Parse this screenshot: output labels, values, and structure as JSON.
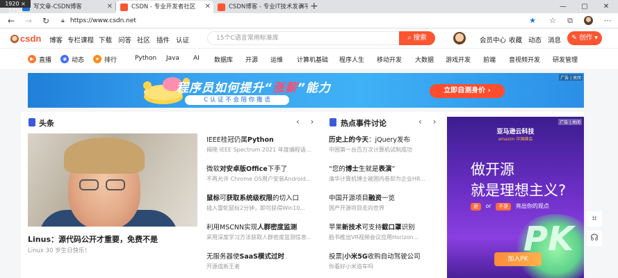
{
  "screen_badge": "1920 × 1030",
  "tabs": [
    {
      "title": "写文章-CSDN博客",
      "active": false,
      "favicon_color": "#1e73d4"
    },
    {
      "title": "CSDN - 专业开发者社区",
      "active": true,
      "favicon_color": "#fc5531"
    },
    {
      "title": "CSDN博客 - 专业IT技术发表平台",
      "active": false,
      "favicon_color": "#fc5531"
    }
  ],
  "tab_close_glyph": "✕",
  "new_tab_glyph": "+",
  "window_controls": {
    "minimize": "—",
    "maximize": "▢",
    "close": "✕"
  },
  "browser": {
    "url": "https://www.csdn.net",
    "icons": {
      "back": "arrow-left",
      "forward": "arrow-right",
      "refresh": "refresh",
      "home": "home",
      "favorite": "star",
      "collections": "collections",
      "extensions": "extensions",
      "profile": "profile-avatar",
      "menu": "more"
    },
    "glyphs": {
      "back": "←",
      "forward": "→",
      "refresh": "↻",
      "home": "⌂",
      "lock": "🔒︎",
      "star": "★",
      "collections": "☆",
      "extensions": "⧉",
      "more": "⋯"
    }
  },
  "header": {
    "logo_text": "csdn",
    "nav": [
      "博客",
      "专栏课程",
      "下载",
      "问答",
      "社区",
      "插件",
      "认证"
    ],
    "search_placeholder": "15个C语言常用标准库",
    "search_button": "搜索",
    "links": [
      "会员中心",
      "收藏",
      "动态",
      "消息"
    ],
    "create_button": "创作",
    "create_dropdown_glyph": "▾"
  },
  "categories": {
    "featured": [
      {
        "label": "直播",
        "icon": "live-icon",
        "color": "#ff7a2f"
      },
      {
        "label": "动态",
        "icon": "dynamic-icon",
        "color": "#3c6bff"
      },
      {
        "label": "排行",
        "icon": "rank-icon",
        "color": "#ff8c1a"
      }
    ],
    "items": [
      "Python",
      "Java",
      "AI",
      "数据库",
      "开源",
      "运维",
      "计算机基础",
      "程序人生",
      "移动开发",
      "大数据",
      "游戏开发",
      "前端",
      "音视频开发",
      "研发管理"
    ]
  },
  "banner": {
    "headline_a": "程序员如何提升“",
    "headline_hot": "涨薪",
    "headline_b": "”能力",
    "subline": "C 认 证 不 会 陪 你 撒 谎",
    "cta": "立即自测身价",
    "ad_tag": "广告 | 关闭"
  },
  "headlines": {
    "title": "头条",
    "arrows": "‹ ›",
    "hero_caption": "Linus：源代码公开才重要，免费不是",
    "hero_meta": "Linux 30 岁生日快乐！",
    "items": [
      {
        "title_pre": "IEEE桂冠仍属",
        "title_bold": "Python",
        "title_post": "",
        "desc": "揭晓 IEEE Spectrum 2021 年度编程语..."
      },
      {
        "title_pre": "微软",
        "title_bold": "对安卓版Office",
        "title_post": "下手了",
        "desc": "不再允许 Chrome OS用户安装Android..."
      },
      {
        "title_pre": "",
        "title_bold": "鼠标",
        "title_post": "可获取系统级权限的切入口",
        "title_bold2": "获取系统级权限",
        "desc": "插入雷蛇鼠标2分钟，即可获得Win10..."
      },
      {
        "title_pre": "利用MSCNN实现",
        "title_bold": "人群密度监测",
        "title_post": "",
        "desc": "采用深度学习方法获取人群密度监测信息..."
      },
      {
        "title_pre": "无服务器使",
        "title_bold": "SaaS模式过时",
        "title_post": "",
        "desc": "开源成新王者"
      }
    ]
  },
  "hot_events": {
    "title": "热点事件讨论",
    "arrows": "‹ ›",
    "items": [
      {
        "title_bold": "历史上的今天",
        "title_post": "：jQuery发布",
        "desc": "中国第一台百万次计算机试制成功"
      },
      {
        "title_pre": "“您的",
        "title_bold": "博士",
        "title_post": "生就是",
        "title_bold2": "表演",
        "title_post2": "”",
        "desc": "清华计算机博士被困内卷却为企业HR..."
      },
      {
        "title_pre": "中国开源项目",
        "title_bold": "融资",
        "title_post": "一览",
        "desc": "国产开源项目走向世界"
      },
      {
        "title_pre": "苹果",
        "title_bold": "新技术",
        "title_post": "可支持",
        "title_bold2": "截口罩",
        "title_post2": "识别",
        "desc": "脸书推出VR视频会议应用Horizon..."
      },
      {
        "title_pre": "投票|",
        "title_bold": "小米5G",
        "title_post": "收购自动驾驶公司",
        "desc": "你看好小米造车吗"
      }
    ]
  },
  "ad": {
    "tag": "广告 | 关闭",
    "brand": "亚马逊云科技",
    "brand_sub": "amazon 中国峰会",
    "line1": "做开源",
    "line2": "就是理想主义?",
    "opt_yes": "是",
    "opt_or": "or",
    "opt_no": "不是",
    "opt_tail": "亮出你的观点",
    "pk": "PK",
    "join_button": "加入PK"
  },
  "sidefloat": [
    "qrcode-icon",
    "customer-service-icon"
  ],
  "side_glyphs": {
    "qrcode": "⌗",
    "service": "☊"
  }
}
